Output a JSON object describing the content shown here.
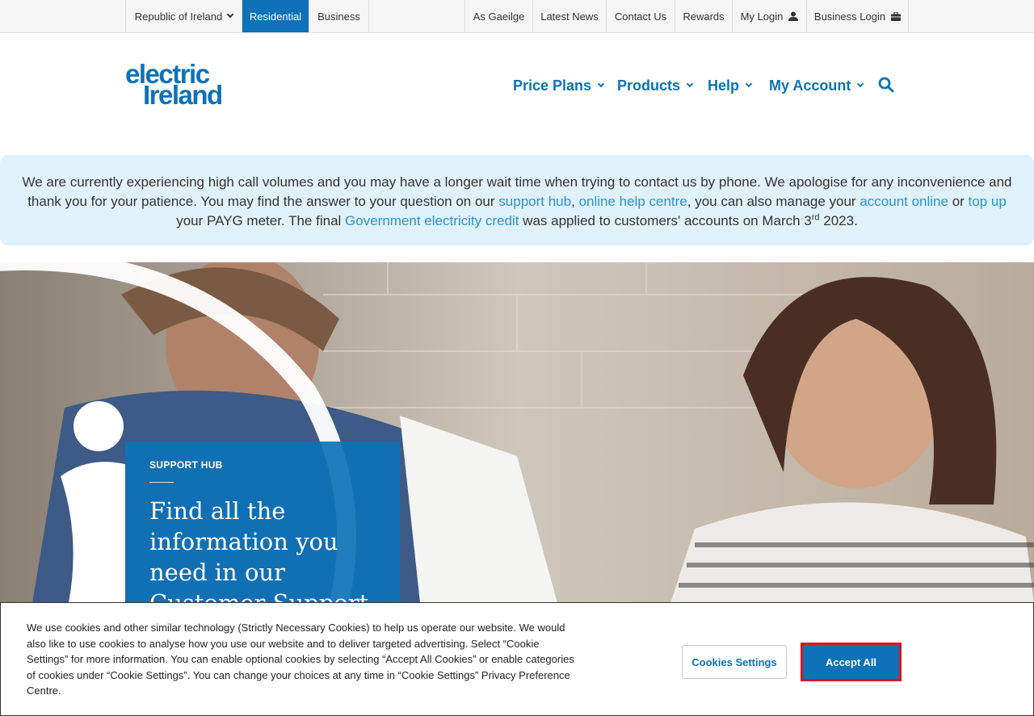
{
  "topbar": {
    "region": "Republic of Ireland",
    "residential": "Residential",
    "business": "Business",
    "as_gaeilge": "As Gaeilge",
    "latest_news": "Latest News",
    "contact_us": "Contact Us",
    "rewards": "Rewards",
    "my_login": "My Login",
    "business_login": "Business Login"
  },
  "header": {
    "logo_line1": "electric",
    "logo_line2": "Ireland",
    "nav": {
      "price_plans": "Price Plans",
      "products": "Products",
      "help": "Help",
      "my_account": "My Account"
    }
  },
  "alert": {
    "t1": "We are currently experiencing high call volumes and you may have a longer wait time when trying to contact us by phone. We apologise for any inconvenience and thank you for your patience. You may find the answer to your question on our ",
    "link_support_hub": "support hub",
    "t2": ", ",
    "link_online_help": "online help centre",
    "t3": ", you can also manage your ",
    "link_account_online": "account online",
    "t4": " or ",
    "link_top_up": "top up",
    "t5": " your PAYG meter. The final ",
    "link_gov_credit": "Government electricity credit",
    "t6": " was applied to customers' accounts on March 3",
    "sup": "rd",
    "t7": " 2023."
  },
  "hero": {
    "label": "SUPPORT HUB",
    "title": "Find all the information you need in our Customer Support Hub"
  },
  "cookie": {
    "text": "We use cookies and other similar technology (Strictly Necessary Cookies) to help us operate our website. We would also like to use cookies to analyse how you use our website and to deliver targeted advertising. Select “Cookie Settings” for more information. You can enable optional cookies by selecting “Accept All Cookies” or enable categories of cookies under “Cookie Settings”. You can change your choices at any time in “Cookie Settings” Privacy Preference Centre.",
    "settings_button": "Cookies Settings",
    "accept_button": "Accept All"
  },
  "colors": {
    "brand_blue": "#0d72b8",
    "link_blue": "#2a93d5",
    "alert_bg": "#dff2fb",
    "accept_outline": "#e0121e"
  }
}
